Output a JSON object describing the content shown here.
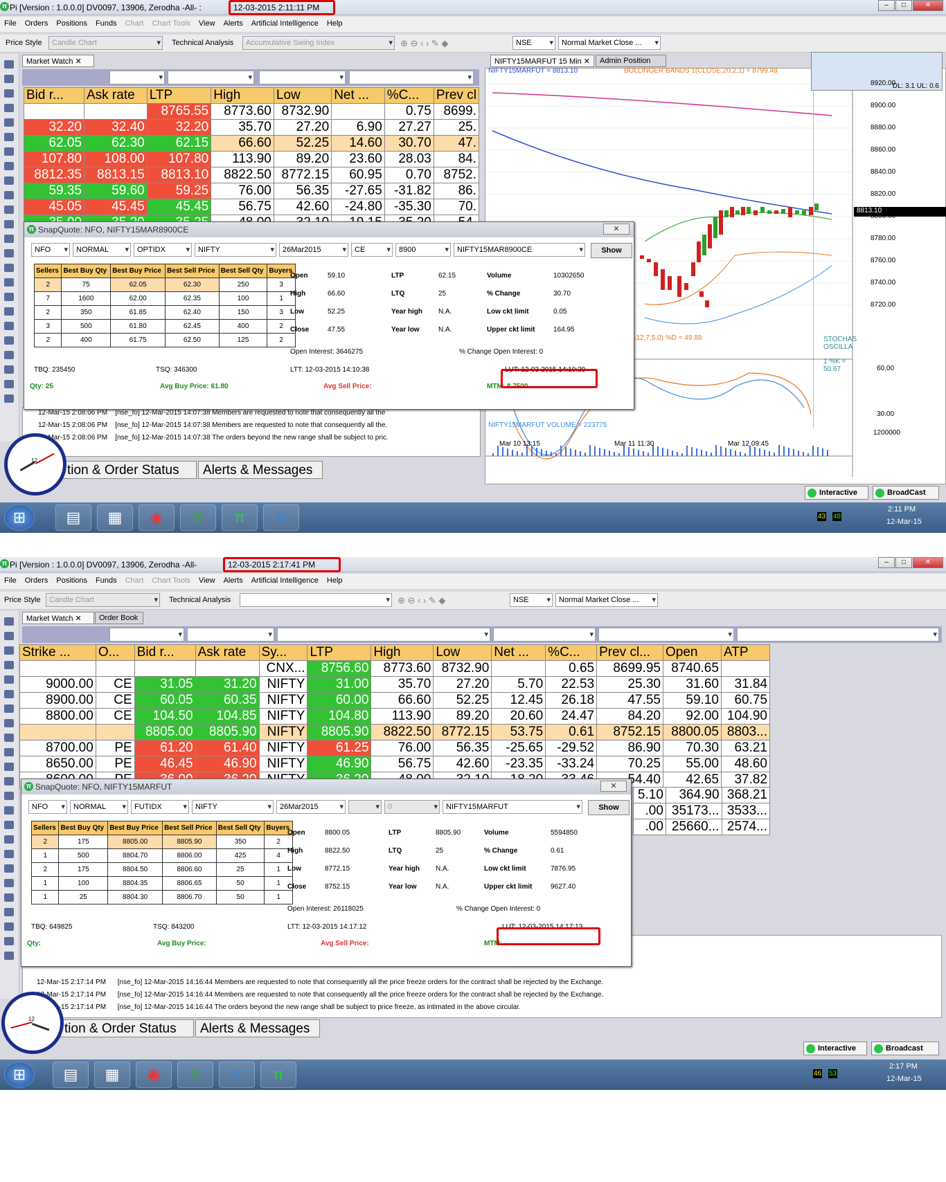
{
  "s1": {
    "title": "Pi [Version : 1.0.0.0] DV0097, 13906, Zerodha -All- :",
    "datetime": "12-03-2015 2:11:11 PM",
    "menu": [
      "File",
      "Orders",
      "Positions",
      "Funds",
      "Chart",
      "Chart Tools",
      "View",
      "Alerts",
      "Artificial Intelligence",
      "Help"
    ],
    "toolbar": {
      "price_style": "Price Style",
      "candle": "Candle Chart",
      "ta": "Technical Analysis",
      "indicator": "Accumulative Swing Index",
      "exch": "NSE",
      "close": "Normal Market Close ..."
    },
    "tab_mw": "Market Watch ✕",
    "cols": [
      "Bid r...",
      "Ask rate",
      "LTP",
      "High",
      "Low",
      "Net ...",
      "%C...",
      "Prev cl"
    ],
    "rows": [
      [
        "",
        "",
        "8765.55",
        "8773.60",
        "8732.90",
        "",
        "0.75",
        "8699."
      ],
      [
        "32.20",
        "32.40",
        "32.20",
        "35.70",
        "27.20",
        "6.90",
        "27.27",
        "25."
      ],
      [
        "62.05",
        "62.30",
        "62.15",
        "66.60",
        "52.25",
        "14.60",
        "30.70",
        "47."
      ],
      [
        "107.80",
        "108.00",
        "107.80",
        "113.90",
        "89.20",
        "23.60",
        "28.03",
        "84."
      ],
      [
        "8812.35",
        "8813.15",
        "8813.10",
        "8822.50",
        "8772.15",
        "60.95",
        "0.70",
        "8752."
      ],
      [
        "59.35",
        "59.60",
        "59.25",
        "76.00",
        "56.35",
        "-27.65",
        "-31.82",
        "86."
      ],
      [
        "45.05",
        "45.45",
        "45.45",
        "56.75",
        "42.60",
        "-24.80",
        "-35.30",
        "70."
      ],
      [
        "35.00",
        "35.20",
        "35.25",
        "48.00",
        "32.10",
        "-19.15",
        "-35.20",
        "54."
      ]
    ],
    "chart_tab1": "NIFTY15MARFUT 15 Min ✕",
    "chart_tab2": "Admin Position",
    "chart_lbl": "NIFTY15MARFUT = 8813.10",
    "bb_lbl": "BOLLINGER BANDS 1(CLOSE,20,2,1) = 8799.48",
    "dl": "DL: 3.1 UL: 0.6",
    "yticks": [
      "8920.00",
      "8900.00",
      "8880.00",
      "8860.00",
      "8840.00",
      "8820.00",
      "8800.00",
      "8780.00",
      "8760.00",
      "8740.00",
      "8720.00"
    ],
    "last_price": "8813.10",
    "stoch_lbl": "UL,12,7,5,0) %D = 49.88",
    "stoch_title": "STOCHAS OSCILLA",
    "stoch_k": "1 %K = 50.67",
    "stoch_ticks": [
      "60.00",
      "30.00"
    ],
    "vol_lbl": "NIFTY15MARFUT VOLUME = 223775",
    "vol_tick": "1200000",
    "xticks": [
      "Mar 10 13:15",
      "Mar 11 11:30",
      "Mar 12 09:45"
    ],
    "snap": {
      "title": "SnapQuote: NFO, NIFTY15MAR8900CE",
      "combos": [
        "NFO",
        "NORMAL",
        "OPTIDX",
        "NIFTY",
        "26Mar2015",
        "CE",
        "8900",
        "NIFTY15MAR8900CE"
      ],
      "show": "Show",
      "heads": [
        "Sellers",
        "Best Buy Qty",
        "Best Buy Price",
        "Best Sell Price",
        "Best Sell Qty",
        "Buyers"
      ],
      "depth": [
        [
          "2",
          "75",
          "62.05",
          "62.30",
          "250",
          "3"
        ],
        [
          "7",
          "1600",
          "62.00",
          "62.35",
          "100",
          "1"
        ],
        [
          "2",
          "350",
          "61.85",
          "62.40",
          "150",
          "3"
        ],
        [
          "3",
          "500",
          "61.80",
          "62.45",
          "400",
          "2"
        ],
        [
          "2",
          "400",
          "61.75",
          "62.50",
          "125",
          "2"
        ]
      ],
      "open_l": "Open",
      "open": "59.10",
      "high_l": "High",
      "high": "66.60",
      "low_l": "Low",
      "low": "52.25",
      "close_l": "Close",
      "close": "47.55",
      "ltp_l": "LTP",
      "ltp": "62.15",
      "ltq_l": "LTQ",
      "ltq": "25",
      "yh_l": "Year high",
      "yh": "N.A.",
      "yl_l": "Year low",
      "yl": "N.A.",
      "vol_l": "Volume",
      "vol": "10302650",
      "pc_l": "% Change",
      "pc": "30.70",
      "lc_l": "Low ckt limit",
      "lc": "0.05",
      "uc_l": "Upper ckt limit",
      "uc": "164.95",
      "oi": "Open Interest:  3646275",
      "coi": "% Change Open Interest:  0",
      "tbq": "TBQ:  235450",
      "tsq": "TSQ:  346300",
      "ltt": "LTT:  12-03-2015 14:10:38",
      "lut": "LUT:  12-03-2015 14:10:39",
      "qty": "Qty:  25",
      "abp": "Avg Buy Price:  61.80",
      "asp": "Avg Sell Price:",
      "mtm": "MTM:  8.7500"
    },
    "msgs": [
      [
        "12-Mar-15 2:08:06 PM",
        "[nse_fo] 12-Mar-2015 14:07:38 Members are requested to note that consequently all the"
      ],
      [
        "12-Mar-15 2:08:06 PM",
        "[nse_fo] 12-Mar-2015 14:07:38 Members are requested to note that consequently all the."
      ],
      [
        "12-Mar-15 2:08:06 PM",
        "[nse_fo] 12-Mar-2015 14:07:38 The orders beyond the new range shall be subject to pric."
      ]
    ],
    "btab1": "tion & Order Status",
    "btab2": "Alerts & Messages",
    "interactive": "Interactive",
    "broadcast": "BroadCast",
    "tray": {
      "a": "43",
      "b": "48",
      "time": "2:11 PM",
      "date": "12-Mar-15"
    }
  },
  "s2": {
    "title": "Pi [Version : 1.0.0.0] DV0097, 13906, Zerodha -All-",
    "datetime": "12-03-2015 2:17:41 PM",
    "menu": [
      "File",
      "Orders",
      "Positions",
      "Funds",
      "Chart",
      "Chart Tools",
      "View",
      "Alerts",
      "Artificial Intelligence",
      "Help"
    ],
    "toolbar": {
      "price_style": "Price Style",
      "candle": "Candle Chart",
      "ta": "Technical Analysis",
      "exch": "NSE",
      "close": "Normal Market Close ..."
    },
    "tab_mw": "Market Watch ✕",
    "tab_ob": "Order Book",
    "cols": [
      "Strike ...",
      "O...",
      "Bid r...",
      "Ask rate",
      "Sy...",
      "LTP",
      "High",
      "Low",
      "Net ...",
      "%C...",
      "Prev cl...",
      "Open",
      "ATP"
    ],
    "rows": [
      [
        "",
        "",
        "",
        "",
        "CNX...",
        "8756.60",
        "8773.60",
        "8732.90",
        "",
        "0.65",
        "8699.95",
        "8740.65",
        ""
      ],
      [
        "9000.00",
        "CE",
        "31.05",
        "31.20",
        "NIFTY",
        "31.00",
        "35.70",
        "27.20",
        "5.70",
        "22.53",
        "25.30",
        "31.60",
        "31.84"
      ],
      [
        "8900.00",
        "CE",
        "60.05",
        "60.35",
        "NIFTY",
        "60.00",
        "66.60",
        "52.25",
        "12.45",
        "26.18",
        "47.55",
        "59.10",
        "60.75"
      ],
      [
        "8800.00",
        "CE",
        "104.50",
        "104.85",
        "NIFTY",
        "104.80",
        "113.90",
        "89.20",
        "20.60",
        "24.47",
        "84.20",
        "92.00",
        "104.90"
      ],
      [
        "",
        "",
        "8805.00",
        "8805.90",
        "NIFTY",
        "8805.90",
        "8822.50",
        "8772.15",
        "53.75",
        "0.61",
        "8752.15",
        "8800.05",
        "8803..."
      ],
      [
        "8700.00",
        "PE",
        "61.20",
        "61.40",
        "NIFTY",
        "61.25",
        "76.00",
        "56.35",
        "-25.65",
        "-29.52",
        "86.90",
        "70.30",
        "63.21"
      ],
      [
        "8650.00",
        "PE",
        "46.45",
        "46.90",
        "NIFTY",
        "46.90",
        "56.75",
        "42.60",
        "-23.35",
        "-33.24",
        "70.25",
        "55.00",
        "48.60"
      ],
      [
        "8600.00",
        "PE",
        "36.00",
        "36.20",
        "NIFTY",
        "36.20",
        "48.00",
        "32.10",
        "-18.20",
        "-33.46",
        "54.40",
        "42.65",
        "37.82"
      ]
    ],
    "extra": [
      [
        "5.10",
        "364.90",
        "368.21"
      ],
      [
        ".00",
        "35173...",
        "3533..."
      ],
      [
        ".00",
        "25660...",
        "2574..."
      ]
    ],
    "snap": {
      "title": "SnapQuote: NFO, NIFTY15MARFUT",
      "combos": [
        "NFO",
        "NORMAL",
        "FUTIDX",
        "NIFTY",
        "26Mar2015",
        "",
        "0",
        "NIFTY15MARFUT"
      ],
      "show": "Show",
      "heads": [
        "Sellers",
        "Best Buy Qty",
        "Best Buy Price",
        "Best Sell Price",
        "Best Sell Qty",
        "Buyers"
      ],
      "depth": [
        [
          "2",
          "175",
          "8805.00",
          "8805.90",
          "350",
          "2"
        ],
        [
          "1",
          "500",
          "8804.70",
          "8806.00",
          "425",
          "4"
        ],
        [
          "2",
          "175",
          "8804.50",
          "8806.60",
          "25",
          "1"
        ],
        [
          "1",
          "100",
          "8804.35",
          "8806.65",
          "50",
          "1"
        ],
        [
          "1",
          "25",
          "8804.30",
          "8806.70",
          "50",
          "1"
        ]
      ],
      "open_l": "Open",
      "open": "8800.05",
      "high_l": "High",
      "high": "8822.50",
      "low_l": "Low",
      "low": "8772.15",
      "close_l": "Close",
      "close": "8752.15",
      "ltp_l": "LTP",
      "ltp": "8805.90",
      "ltq_l": "LTQ",
      "ltq": "25",
      "yh_l": "Year high",
      "yh": "N.A.",
      "yl_l": "Year low",
      "yl": "N.A.",
      "vol_l": "Volume",
      "vol": "5594850",
      "pc_l": "% Change",
      "pc": "0.61",
      "lc_l": "Low ckt limit",
      "lc": "7876.95",
      "uc_l": "Upper ckt limit",
      "uc": "9627.40",
      "oi": "Open Interest:  26118025",
      "coi": "% Change Open Interest:  0",
      "tbq": "TBQ:  649825",
      "tsq": "TSQ:  843200",
      "ltt": "LTT:  12-03-2015 14:17:12",
      "lut": "LUT:  12-03-2015 14:17:13",
      "qty": "Qty:",
      "abp": "Avg Buy Price:",
      "asp": "Avg Sell Price:",
      "mtm": "MTM:"
    },
    "msgs": [
      [
        "12-Mar-15 2:17:14 PM",
        "[nse_fo] 12-Mar-2015 14:16:44 Members are requested to note that consequently all the price freeze orders for the contract shall be rejected by the Exchange."
      ],
      [
        "12-Mar-15 2:17:14 PM",
        "[nse_fo] 12-Mar-2015 14:16:44 Members are requested to note that consequently all the price freeze orders for the contract shall be rejected by the Exchange."
      ],
      [
        "12-Mar-15 2:17:14 PM",
        "[nse_fo] 12-Mar-2015 14:16:44 The orders beyond the new range shall be subject to price freeze,              as intimated in the above circular."
      ]
    ],
    "btab1": "tion & Order Status",
    "btab2": "Alerts & Messages",
    "interactive": "Interactive",
    "broadcast": "Broadcast",
    "tray": {
      "a": "46",
      "b": "53",
      "time": "2:17 PM",
      "date": "12-Mar-15"
    }
  },
  "colors": {
    "green": "#33c233",
    "red": "#f0503a",
    "orange": "#fddcac",
    "header": "#f7c96a",
    "highlight": "#d00000"
  }
}
